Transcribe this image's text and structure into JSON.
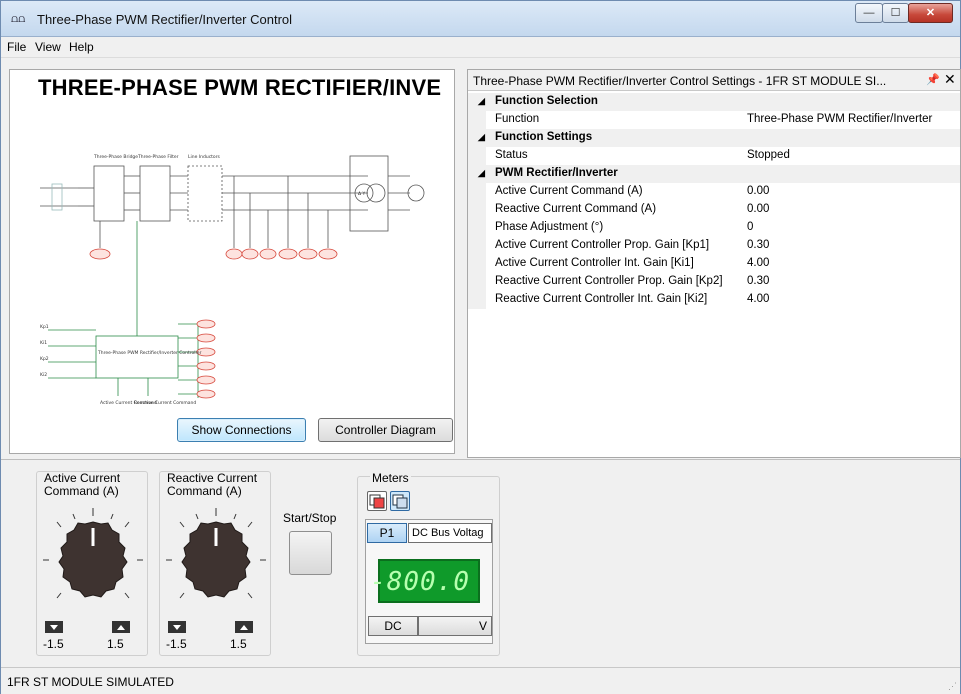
{
  "window": {
    "title": "Three-Phase PWM Rectifier/Inverter Control",
    "icon": "app-icon",
    "controls": {
      "minimize": "—",
      "maximize": "☐",
      "close": "✕"
    }
  },
  "menu": [
    {
      "label": "File"
    },
    {
      "label": "View"
    },
    {
      "label": "Help"
    }
  ],
  "diagram": {
    "title": "THREE-PHASE  PWM RECTIFIER/INVE",
    "labels": {
      "bridge": "Three-Phase Bridge",
      "filter": "Three-Phase Filter",
      "inductors": "Line Inductors",
      "controller": "Three-Phase PWM Rectifier/Inverter Controller",
      "active_cmd": "Active Current Command",
      "reactive_cmd": "Reactive Current Command",
      "kp1": "Kp1",
      "ki1": "Ki1",
      "kp2": "Kp2",
      "ki2": "Ki2",
      "delta_y": "Δ Y"
    },
    "show_connections": "Show Connections",
    "controller_diagram": "Controller Diagram"
  },
  "settings": {
    "title": "Three-Phase PWM Rectifier/Inverter Control Settings - 1FR ST MODULE SI...",
    "pin": "📌",
    "close": "✕",
    "categories": [
      {
        "name": "Function Selection",
        "rows": [
          {
            "name": "Function",
            "value": "Three-Phase PWM Rectifier/Inverter"
          }
        ]
      },
      {
        "name": "Function Settings",
        "rows": [
          {
            "name": "Status",
            "value": "Stopped"
          }
        ]
      },
      {
        "name": "PWM Rectifier/Inverter",
        "rows": [
          {
            "name": "Active Current Command (A)",
            "value": "0.00"
          },
          {
            "name": "Reactive Current Command (A)",
            "value": "0.00"
          },
          {
            "name": "Phase Adjustment (°)",
            "value": "0"
          },
          {
            "name": "Active Current Controller Prop. Gain [Kp1]",
            "value": "0.30"
          },
          {
            "name": "Active Current Controller Int. Gain [Ki1]",
            "value": "4.00"
          },
          {
            "name": "Reactive Current Controller Prop. Gain [Kp2]",
            "value": "0.30"
          },
          {
            "name": "Reactive Current Controller Int. Gain [Ki2]",
            "value": "4.00"
          }
        ]
      }
    ]
  },
  "controls": {
    "active_knob": {
      "label": "Active Current Command (A)",
      "min": "-1.5",
      "max": "1.5",
      "level": 0.5
    },
    "reactive_knob": {
      "label": "Reactive Current Command (A)",
      "min": "-1.5",
      "max": "1.5",
      "level": 0.5
    },
    "start_stop": "Start/Stop"
  },
  "meters": {
    "label": "Meters",
    "tab": "P1",
    "quantity": "DC Bus Voltag",
    "value": "-800.0",
    "mode": "DC",
    "unit": "V",
    "display_color": "#0f9a2a"
  },
  "status": {
    "text": "1FR ST MODULE SIMULATED"
  }
}
